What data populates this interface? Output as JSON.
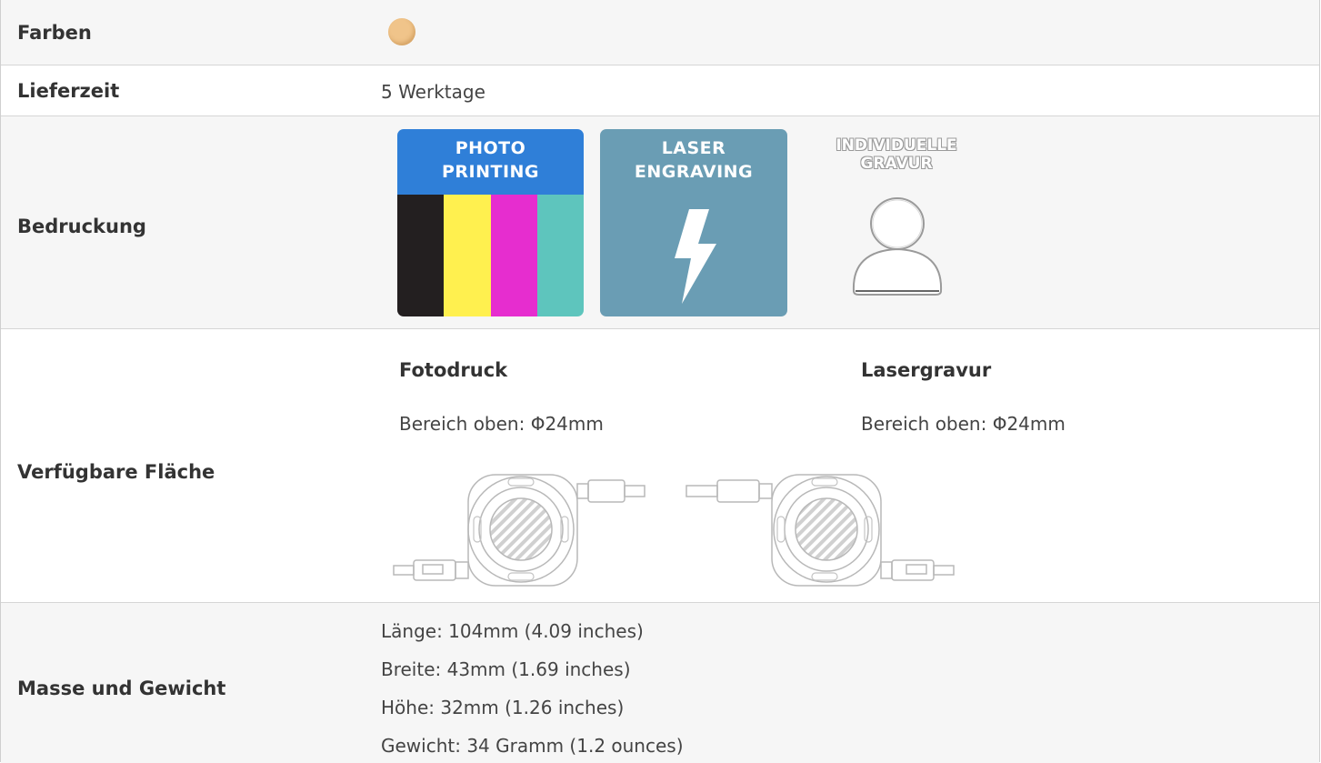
{
  "rows": {
    "farben": {
      "label": "Farben",
      "swatch_color": "#f0c48a"
    },
    "lieferzeit": {
      "label": "Lieferzeit",
      "value": "5 Werktage"
    },
    "bedruckung": {
      "label": "Bedruckung",
      "photo_printing": {
        "line1": "PHOTO",
        "line2": "PRINTING",
        "header_color": "#2f7fd8",
        "stripe_colors": [
          "#231f20",
          "#fff04f",
          "#e62dcf",
          "#5ec5bd"
        ]
      },
      "laser_engraving": {
        "line1": "LASER",
        "line2": "ENGRAVING",
        "color": "#6a9db4",
        "icon": "lightning-bolt-icon"
      },
      "individuelle_gravur": {
        "line1": "INDIVIDUELLE",
        "line2": "GRAVUR",
        "icon": "person-icon"
      }
    },
    "flaeche": {
      "label": "Verfügbare Fläche",
      "fotodruck": {
        "title": "Fotodruck",
        "text": "Bereich oben: Φ24mm"
      },
      "lasergravur": {
        "title": "Lasergravur",
        "text": "Bereich oben: Φ24mm"
      },
      "illustration": "retractable-cable-product-icon"
    },
    "masse": {
      "label": "Masse und Gewicht",
      "lines": [
        "Länge: 104mm (4.09 inches)",
        "Breite: 43mm (1.69 inches)",
        "Höhe: 32mm (1.26 inches)",
        "Gewicht: 34 Gramm (1.2 ounces)"
      ]
    }
  }
}
